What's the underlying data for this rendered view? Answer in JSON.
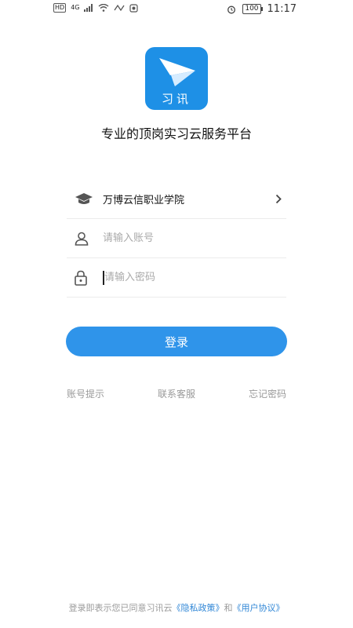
{
  "status_bar": {
    "hd": "HD",
    "net": "4G",
    "battery": "100",
    "time": "11:17"
  },
  "logo": {
    "text": "习讯",
    "color": "#1e90e6"
  },
  "slogan": "专业的顶岗实习云服务平台",
  "form": {
    "school": "万博云信职业学院",
    "account_placeholder": "请输入账号",
    "password_placeholder": "请输入密码"
  },
  "login": {
    "label": "登录",
    "color": "#2f94ea"
  },
  "links": {
    "account_hint": "账号提示",
    "contact_support": "联系客服",
    "forgot_password": "忘记密码"
  },
  "footer": {
    "prefix": "登录即表示您已同意习讯云",
    "privacy": "《隐私政策》",
    "and": "和",
    "agreement": "《用户协议》"
  }
}
